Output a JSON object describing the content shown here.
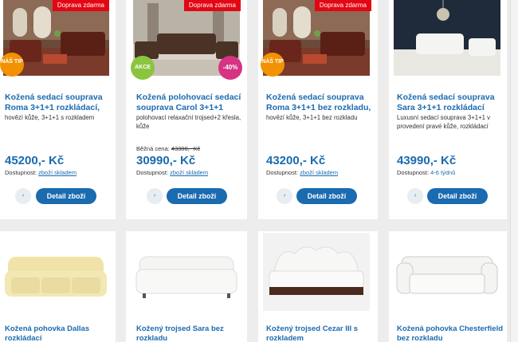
{
  "products": [
    {
      "ribbon": "Doprava zdarma",
      "badge_tip": "NÁŠ TIP",
      "title": "Kožená sedací souprava Roma 3+1+1 rozkládací,",
      "desc": "hovězí kůže, 3+1+1 s rozkladem",
      "price": "45200,- Kč",
      "availability_label": "Dostupnost:",
      "availability_value": "zboží skladem",
      "detail_label": "Detail zboží",
      "arrow": "›"
    },
    {
      "ribbon": "Doprava zdarma",
      "badge_akce": "AKCE",
      "badge_pct": "-40%",
      "title": "Kožená polohovací sedací souprava Carol 3+1+1",
      "desc": "polohovací relaxační trojsed+2 křesla, kůže",
      "old_price_label": "Běžná cena:",
      "old_price_value": "43300,- Kč",
      "price": "30990,- Kč",
      "availability_label": "Dostupnost:",
      "availability_value": "zboží skladem",
      "detail_label": "Detail zboží",
      "arrow": "›"
    },
    {
      "ribbon": "Doprava zdarma",
      "badge_tip": "NÁŠ TIP",
      "title": "Kožená sedací souprava Roma 3+1+1 bez rozkladu,",
      "desc": "hovězí kůže, 3+1+1 bez rozkladu",
      "price": "43200,- Kč",
      "availability_label": "Dostupnost:",
      "availability_value": "zboží skladem",
      "detail_label": "Detail zboží",
      "arrow": "›"
    },
    {
      "title": "Kožená sedací souprava Sara 3+1+1 rozkládací",
      "desc": "Luxusní sedací souprava 3+1+1 v provedení pravé kůže, rozkládací",
      "price": "43990,- Kč",
      "availability_label": "Dostupnost:",
      "availability_value": "4-6 týdnů",
      "detail_label": "Detail zboží",
      "arrow": "›"
    }
  ],
  "products_row2": [
    {
      "title": "Kožená pohovka Dallas rozkládací"
    },
    {
      "title": "Kožený trojsed Sara bez rozkladu"
    },
    {
      "title": "Kožený trojsed Cezar III s rozkladem"
    },
    {
      "title": "Kožená pohovka Chesterfield bez rozkladu"
    }
  ],
  "colors": {
    "link_blue": "#1a6bb0",
    "ribbon_red": "#e30613",
    "tip_orange": "#f39200",
    "akce_green": "#8bc53f",
    "pct_pink": "#d63384"
  }
}
